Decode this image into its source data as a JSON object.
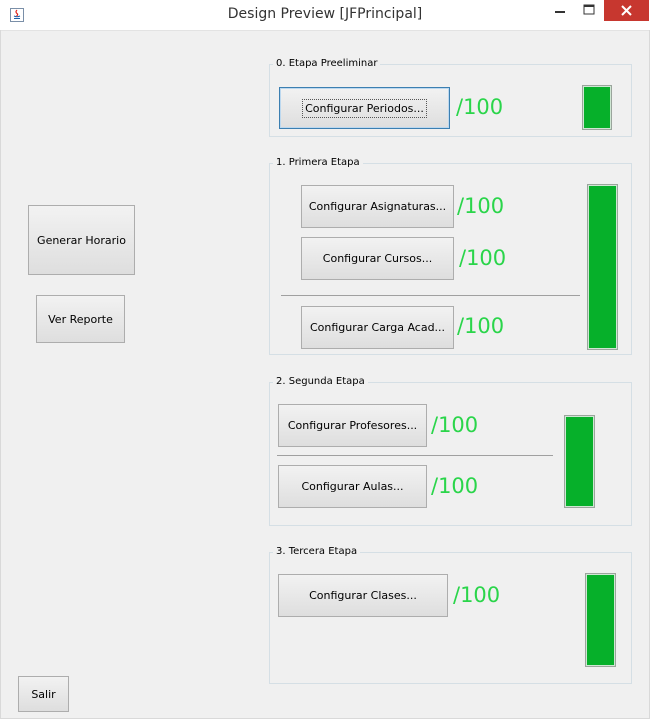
{
  "window": {
    "title": "Design Preview [JFPrincipal]",
    "controls": {
      "minimize_icon": "minimize-icon",
      "maximize_icon": "maximize-icon",
      "close_icon": "close-icon"
    }
  },
  "left": {
    "generar_horario": "Generar Horario",
    "ver_reporte": "Ver Reporte",
    "salir": "Salir"
  },
  "stages": [
    {
      "title": "0. Etapa Preeliminar",
      "buttons": [
        "Configurar Periodos..."
      ],
      "scores": [
        "/100"
      ],
      "progress": 1.0
    },
    {
      "title": "1. Primera Etapa",
      "buttons": [
        "Configurar Asignaturas...",
        "Configurar Cursos...",
        "Configurar Carga Acad..."
      ],
      "scores": [
        "/100",
        "/100",
        "/100"
      ],
      "progress": 1.0
    },
    {
      "title": "2. Segunda Etapa",
      "buttons": [
        "Configurar Profesores...",
        "Configurar Aulas..."
      ],
      "scores": [
        "/100",
        "/100"
      ],
      "progress": 1.0
    },
    {
      "title": "3. Tercera Etapa",
      "buttons": [
        "Configurar Clases..."
      ],
      "scores": [
        "/100"
      ],
      "progress": 1.0
    }
  ],
  "colors": {
    "score_text": "#2ad54a",
    "progress_fill": "#06b02a",
    "close_button": "#c7372f"
  }
}
